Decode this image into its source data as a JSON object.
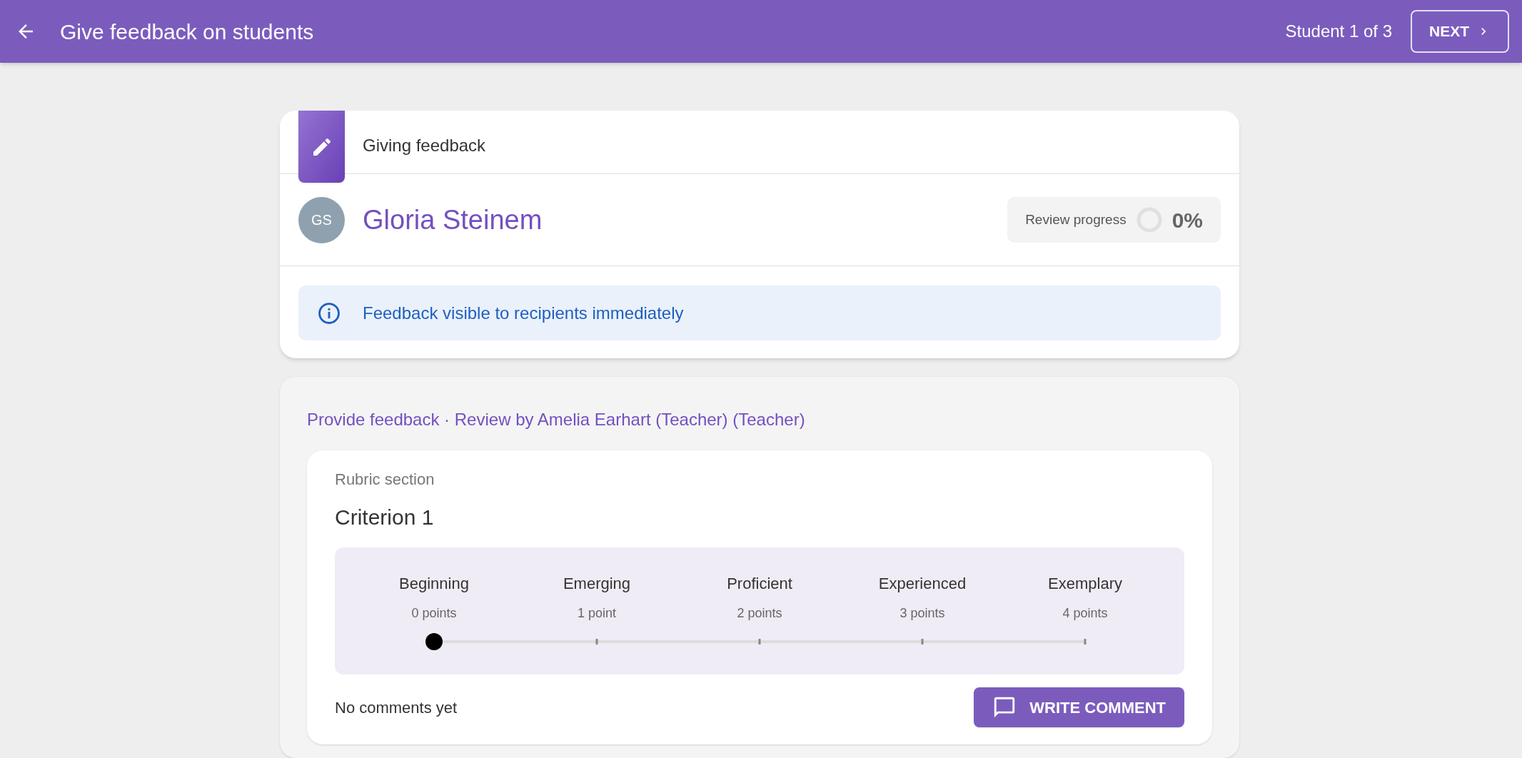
{
  "header": {
    "title": "Give feedback on students",
    "counter": "Student 1 of 3",
    "next_button": "NEXT"
  },
  "feedback_card": {
    "tab_label": "Giving feedback",
    "student": {
      "initials": "GS",
      "name": "Gloria Steinem"
    },
    "progress": {
      "label": "Review progress",
      "level": 0,
      "reading": "0%"
    },
    "notice": "Feedback visible to recipients immediately"
  },
  "review": {
    "heading": "Provide feedback · Review by Amelia Earhart (Teacher) (Teacher)",
    "section_label": "Rubric section",
    "criterion": "Criterion 1",
    "levels": [
      {
        "name": "Beginning",
        "points": "0 points"
      },
      {
        "name": "Emerging",
        "points": "1 point"
      },
      {
        "name": "Proficient",
        "points": "2 points"
      },
      {
        "name": "Experienced",
        "points": "3 points"
      },
      {
        "name": "Exemplary",
        "points": "4 points"
      }
    ],
    "slider": {
      "level": 0
    },
    "comments_note": "No comments yet",
    "comment_button": "WRITE COMMENT"
  }
}
